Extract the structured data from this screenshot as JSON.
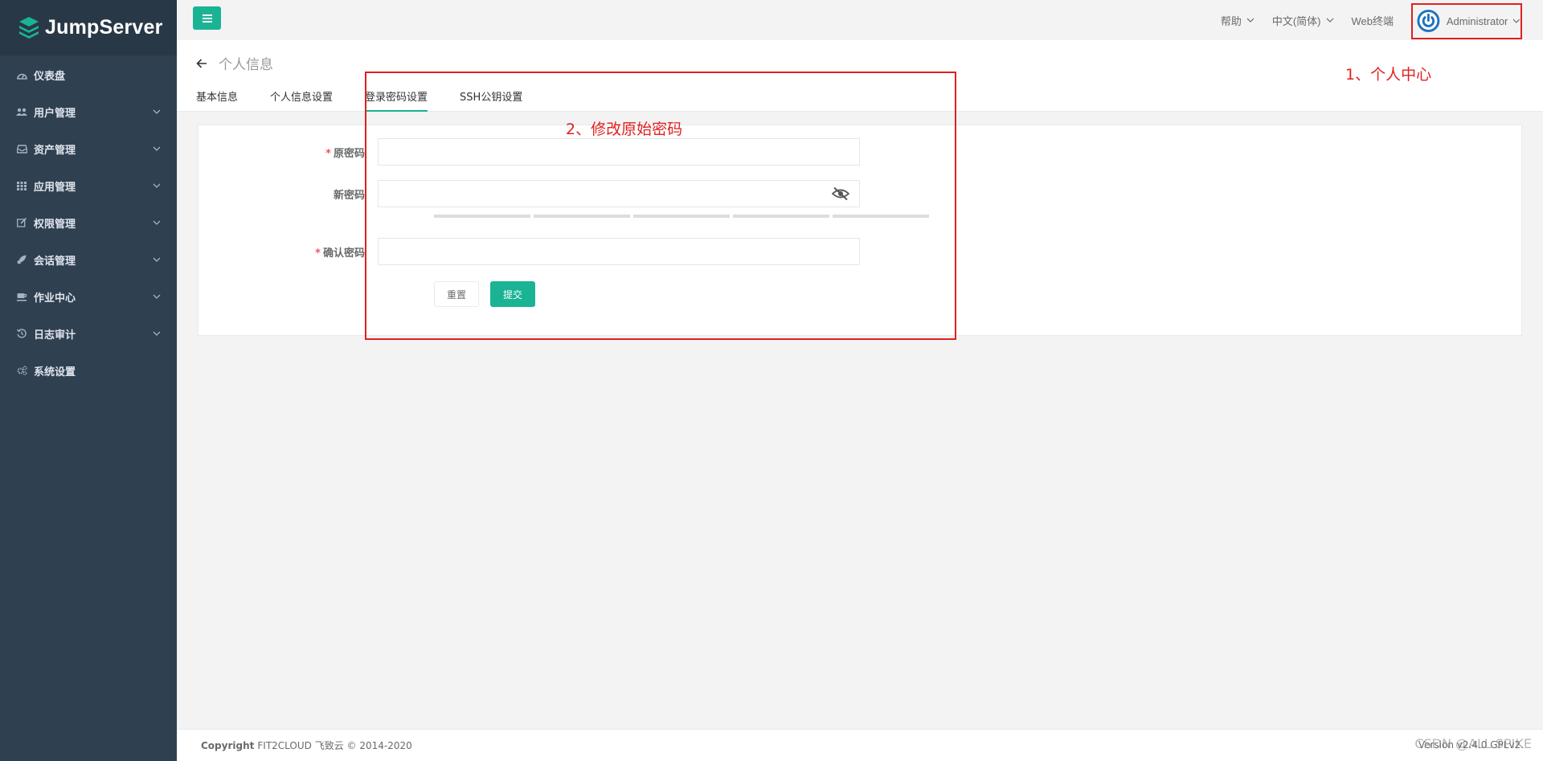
{
  "app": {
    "name": "JumpServer"
  },
  "sidebar": {
    "items": [
      {
        "label": "仪表盘",
        "icon": "dashboard-icon",
        "has_children": false
      },
      {
        "label": "用户管理",
        "icon": "users-icon",
        "has_children": true
      },
      {
        "label": "资产管理",
        "icon": "inbox-icon",
        "has_children": true
      },
      {
        "label": "应用管理",
        "icon": "grid-icon",
        "has_children": true
      },
      {
        "label": "权限管理",
        "icon": "edit-icon",
        "has_children": true
      },
      {
        "label": "会话管理",
        "icon": "rocket-icon",
        "has_children": true
      },
      {
        "label": "作业中心",
        "icon": "coffee-icon",
        "has_children": true
      },
      {
        "label": "日志审计",
        "icon": "history-icon",
        "has_children": true
      },
      {
        "label": "系统设置",
        "icon": "gears-icon",
        "has_children": false
      }
    ]
  },
  "topnav": {
    "help": "帮助",
    "language": "中文(简体)",
    "web_terminal": "Web终端",
    "user": "Administrator"
  },
  "page": {
    "title": "个人信息",
    "tabs": [
      {
        "label": "基本信息",
        "active": false
      },
      {
        "label": "个人信息设置",
        "active": false
      },
      {
        "label": "登录密码设置",
        "active": true
      },
      {
        "label": "SSH公钥设置",
        "active": false
      }
    ]
  },
  "form": {
    "old_password_label": "原密码",
    "new_password_label": "新密码",
    "confirm_password_label": "确认密码",
    "old_password_value": "",
    "new_password_value": "",
    "confirm_password_value": "",
    "reset_label": "重置",
    "submit_label": "提交"
  },
  "annotations": {
    "user_center": "1、个人中心",
    "change_password": "2、修改原始密码"
  },
  "footer": {
    "copyright_bold": "Copyright",
    "copyright_text": "FIT2CLOUD 飞致云 © 2014-2020",
    "version": "Version v2.4.0 GPLv2."
  },
  "watermark": "CSDN @ALL SPIKE",
  "colors": {
    "sidebar_bg": "#2f4050",
    "accent": "#1ab394",
    "annotation": "#e02020"
  }
}
